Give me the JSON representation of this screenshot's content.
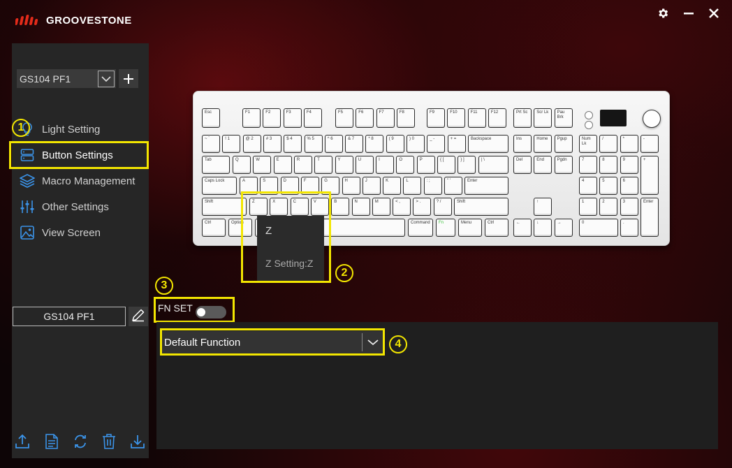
{
  "app": {
    "brand": "GROOVESTONE"
  },
  "window": {
    "settings_icon": "gear-icon",
    "minimize_icon": "minus-icon",
    "close_icon": "close-icon"
  },
  "sidebar": {
    "profile_select": "GS104 PF1",
    "items": [
      {
        "label": "Light Setting",
        "icon": "lightbulb-icon"
      },
      {
        "label": "Button Settings",
        "icon": "server-icon"
      },
      {
        "label": "Macro Management",
        "icon": "layers-icon"
      },
      {
        "label": "Other Settings",
        "icon": "sliders-icon"
      },
      {
        "label": "View Screen",
        "icon": "image-icon"
      }
    ],
    "profile_name": "GS104 PF1",
    "bottom_icons": [
      "upload-icon",
      "document-icon",
      "sync-icon",
      "trash-icon",
      "download-icon"
    ]
  },
  "callouts": {
    "c1": "1",
    "c2": "2",
    "c3": "3",
    "c4": "4"
  },
  "keyboard": {
    "tooltip_key": "Z",
    "tooltip_setting": "Z Setting:Z"
  },
  "fn_set": {
    "label": "FN SET",
    "enabled": false
  },
  "function_select": {
    "value": "Default Function"
  },
  "colors": {
    "accent": "#f3e600",
    "icon_blue": "#3b93e8",
    "fn_green": "#4ad24a"
  }
}
